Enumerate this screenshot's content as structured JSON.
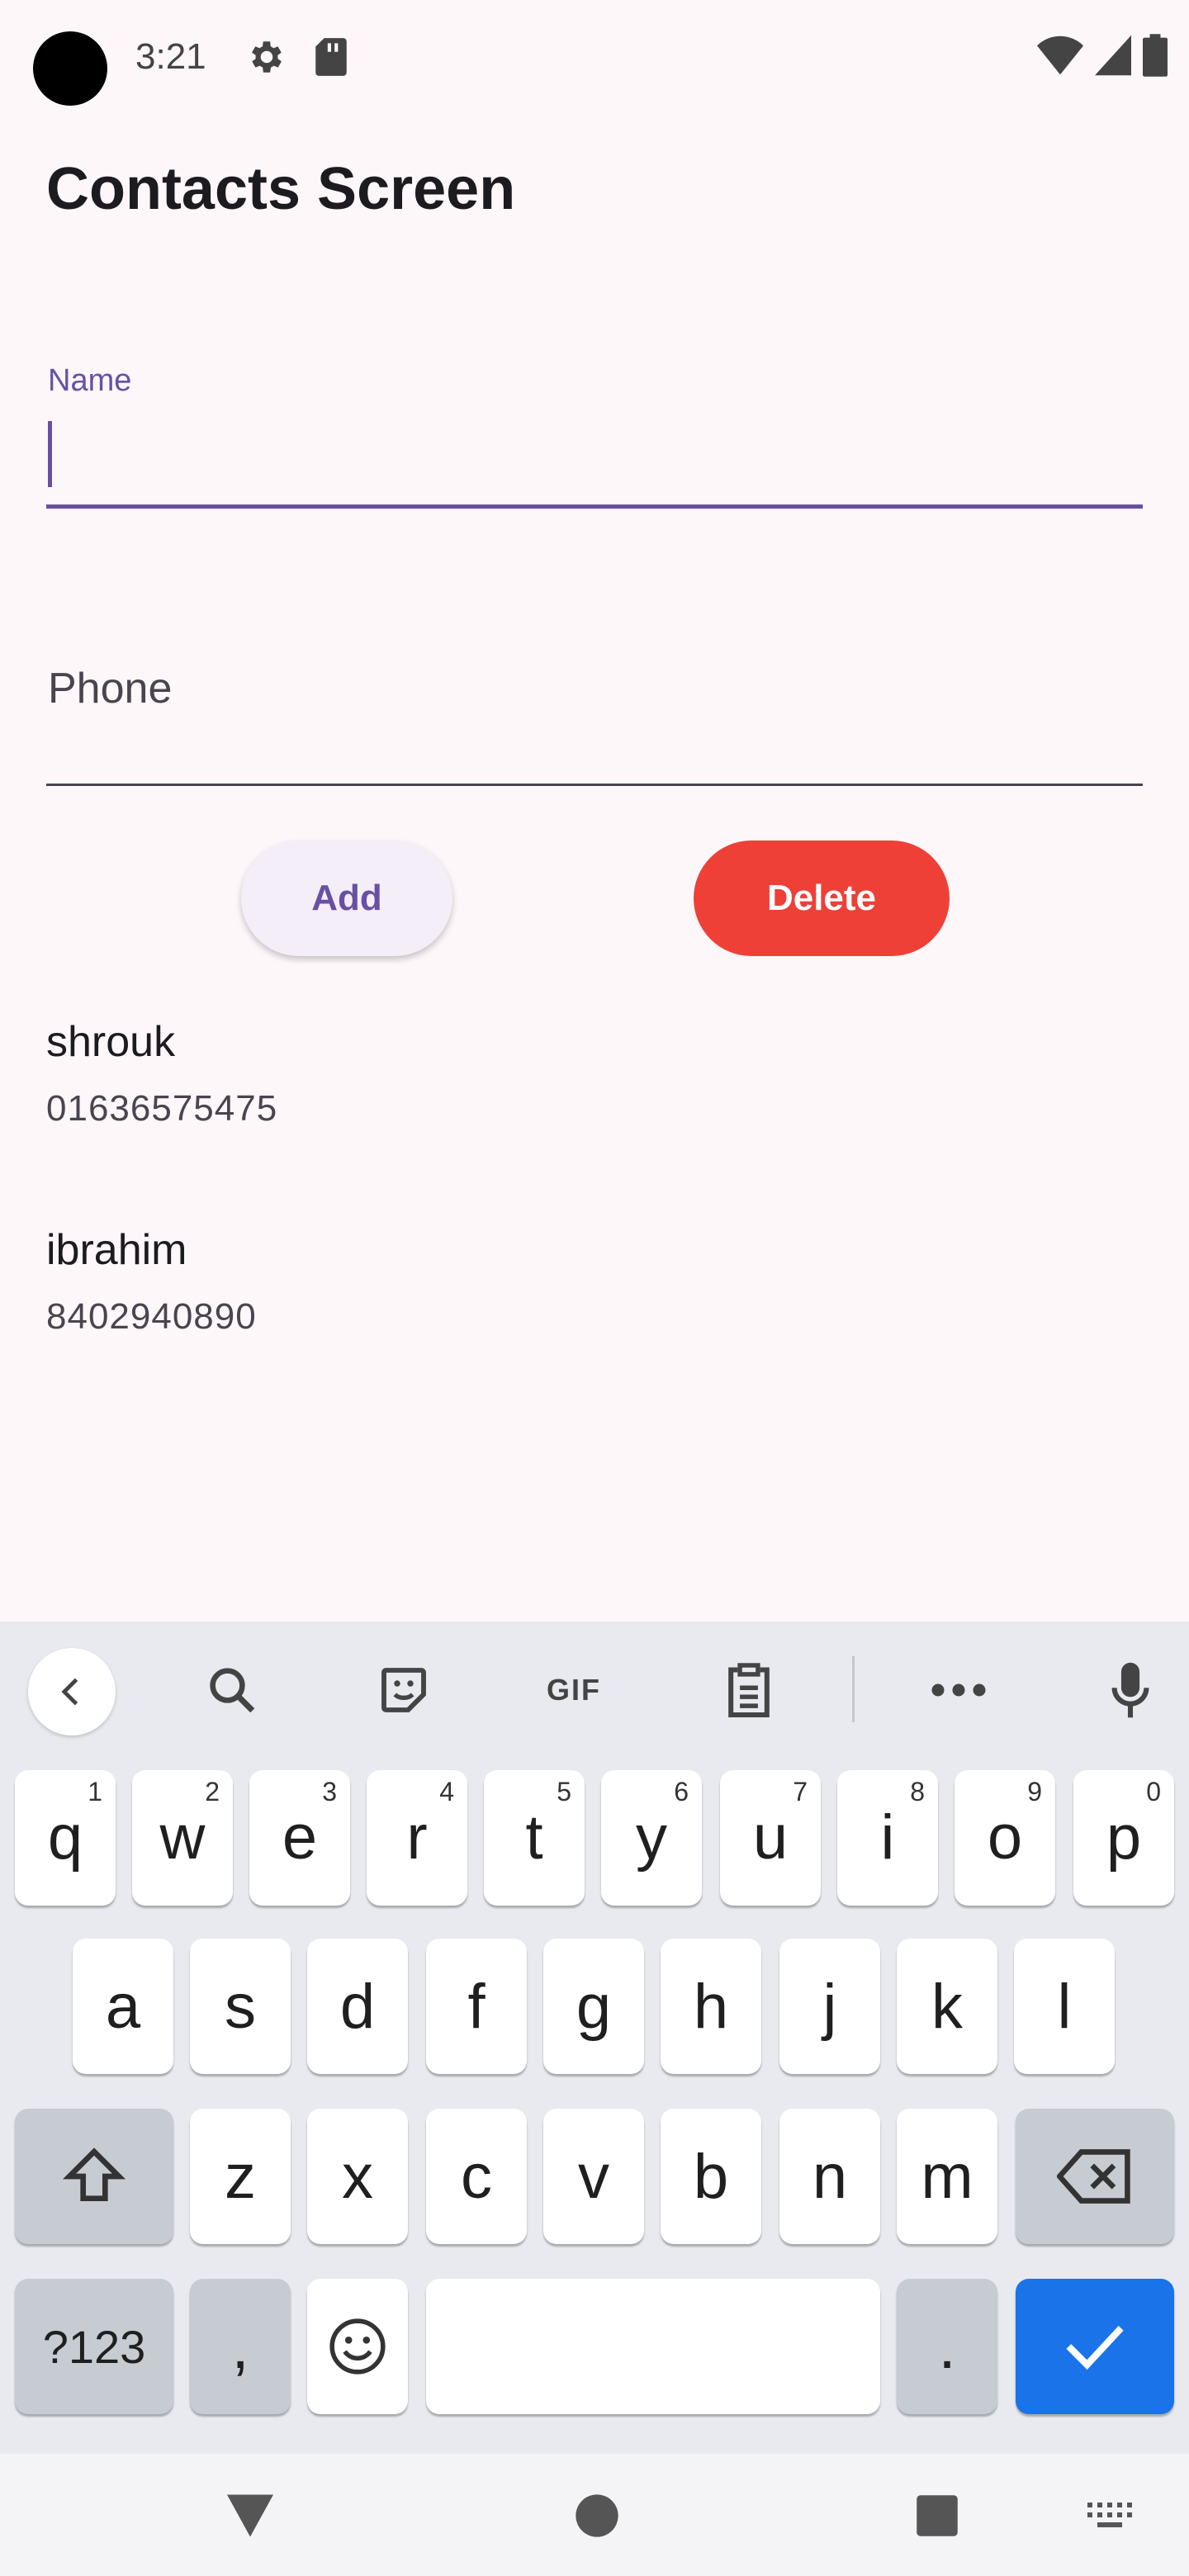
{
  "status_bar": {
    "time": "3:21",
    "icons": [
      "gear-icon",
      "sd-card-icon",
      "wifi-icon",
      "signal-icon",
      "battery-icon"
    ]
  },
  "app": {
    "title": "Contacts Screen",
    "name_field": {
      "label": "Name",
      "value": ""
    },
    "phone_field": {
      "label": "Phone",
      "value": ""
    },
    "add_button": "Add",
    "delete_button": "Delete",
    "contacts": [
      {
        "name": "shrouk",
        "phone": "01636575475"
      },
      {
        "name": "ibrahim",
        "phone": "8402940890"
      }
    ],
    "colors": {
      "primary": "#6750a4",
      "delete": "#ee4037",
      "background": "#fef7fa"
    }
  },
  "keyboard": {
    "toolbar": {
      "icons": [
        "chevron-left-icon",
        "search-icon",
        "sticker-icon",
        "gif-icon",
        "clipboard-icon",
        "more-icon",
        "mic-icon"
      ],
      "gif_label": "GIF"
    },
    "row1": [
      {
        "key": "q",
        "hint": "1"
      },
      {
        "key": "w",
        "hint": "2"
      },
      {
        "key": "e",
        "hint": "3"
      },
      {
        "key": "r",
        "hint": "4"
      },
      {
        "key": "t",
        "hint": "5"
      },
      {
        "key": "y",
        "hint": "6"
      },
      {
        "key": "u",
        "hint": "7"
      },
      {
        "key": "i",
        "hint": "8"
      },
      {
        "key": "o",
        "hint": "9"
      },
      {
        "key": "p",
        "hint": "0"
      }
    ],
    "row2": [
      "a",
      "s",
      "d",
      "f",
      "g",
      "h",
      "j",
      "k",
      "l"
    ],
    "row3": [
      "z",
      "x",
      "c",
      "v",
      "b",
      "n",
      "m"
    ],
    "row4": {
      "symbols": "?123",
      "comma": ",",
      "period": "."
    },
    "enter_color": "#1a73e8"
  },
  "nav_bar": {
    "icons": [
      "back-icon",
      "home-icon",
      "recents-icon",
      "keyboard-switch-icon"
    ]
  }
}
